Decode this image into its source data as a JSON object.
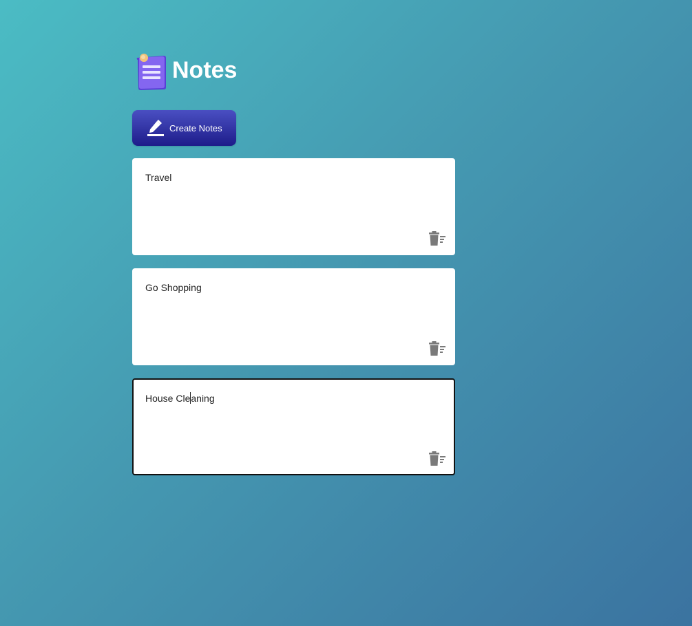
{
  "header": {
    "title": "Notes",
    "logo_icon": "notepad-icon"
  },
  "toolbar": {
    "create_label": "Create Notes",
    "create_icon": "pen-icon"
  },
  "notes": [
    {
      "text": "Travel",
      "active": false
    },
    {
      "text": "Go Shopping",
      "active": false
    },
    {
      "text_before_caret": "House Cle",
      "text_after_caret": "aning",
      "active": true
    }
  ],
  "colors": {
    "accent": "#2a2a9e",
    "logo": "#7b5ce8",
    "icon": "#7a7a7a"
  }
}
